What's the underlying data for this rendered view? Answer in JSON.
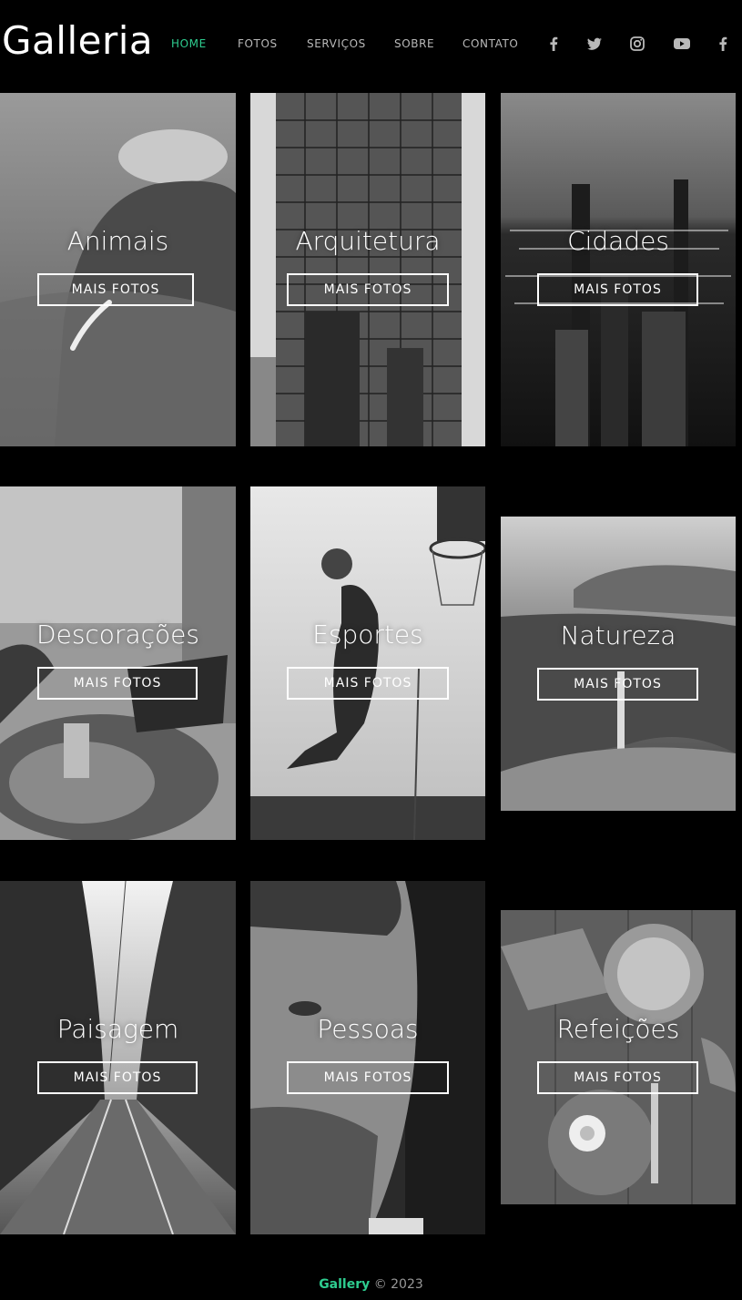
{
  "header": {
    "logo": "Galleria",
    "nav": [
      {
        "label": "HOME",
        "active": true
      },
      {
        "label": "FOTOS",
        "active": false
      },
      {
        "label": "SERVIÇOS",
        "active": false
      },
      {
        "label": "SOBRE",
        "active": false
      },
      {
        "label": "CONTATO",
        "active": false
      }
    ],
    "social": [
      "facebook-icon",
      "twitter-icon",
      "instagram-icon",
      "youtube-icon",
      "facebook-icon"
    ]
  },
  "gallery": {
    "button_label": "MAIS FOTOS",
    "cards": [
      {
        "title": "Animais",
        "image": "elephant-photo"
      },
      {
        "title": "Arquitetura",
        "image": "skyscraper-photo"
      },
      {
        "title": "Cidades",
        "image": "city-night-photo"
      },
      {
        "title": "Descorações",
        "image": "cafe-table-photo"
      },
      {
        "title": "Esportes",
        "image": "basketball-photo"
      },
      {
        "title": "Natureza",
        "image": "waterfall-cliff-photo"
      },
      {
        "title": "Paisagem",
        "image": "railway-forest-photo"
      },
      {
        "title": "Pessoas",
        "image": "man-portrait-photo"
      },
      {
        "title": "Refeições",
        "image": "breakfast-table-photo"
      }
    ]
  },
  "footer": {
    "brand": "Gallery",
    "copyright": "© 2023"
  },
  "colors": {
    "accent": "#2ecc8f",
    "background": "#000000",
    "nav_text": "#b9b9b9"
  }
}
